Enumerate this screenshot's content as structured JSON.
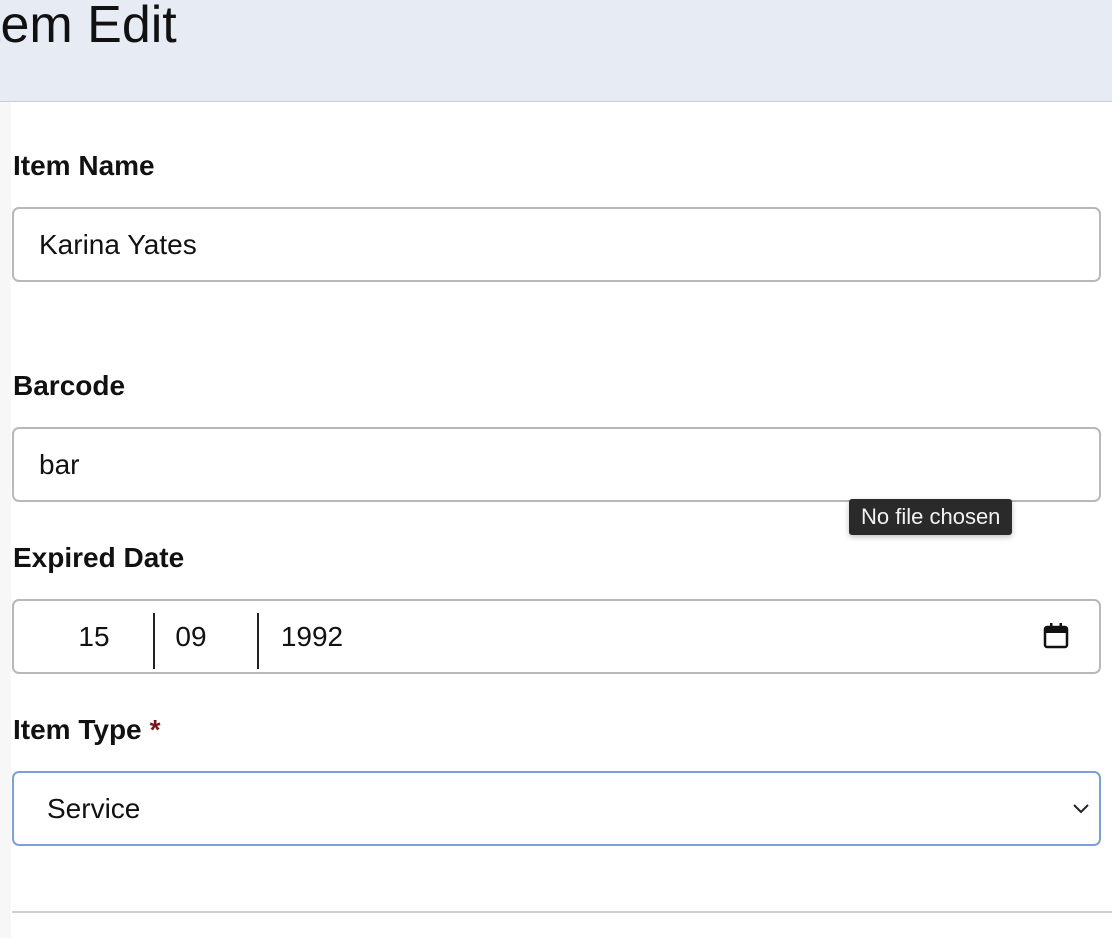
{
  "header": {
    "title": "tem Edit"
  },
  "form": {
    "item_name": {
      "label": "Item Name",
      "value": "Karina Yates"
    },
    "barcode": {
      "label": "Barcode",
      "value": "bar"
    },
    "expired_date": {
      "label": "Expired Date",
      "day": "15",
      "month": "09",
      "year": "1992"
    },
    "item_type": {
      "label": "Item Type",
      "required_marker": "*",
      "selected": "Service"
    }
  },
  "tooltip": {
    "text": "No file chosen"
  },
  "icons": {
    "date_picker": "calendar-icon",
    "select_arrow": "chevron-down-icon"
  },
  "colors": {
    "header_bg": "#e7ebf3",
    "required": "#7a1418",
    "focus_border": "#7f9fdc"
  }
}
